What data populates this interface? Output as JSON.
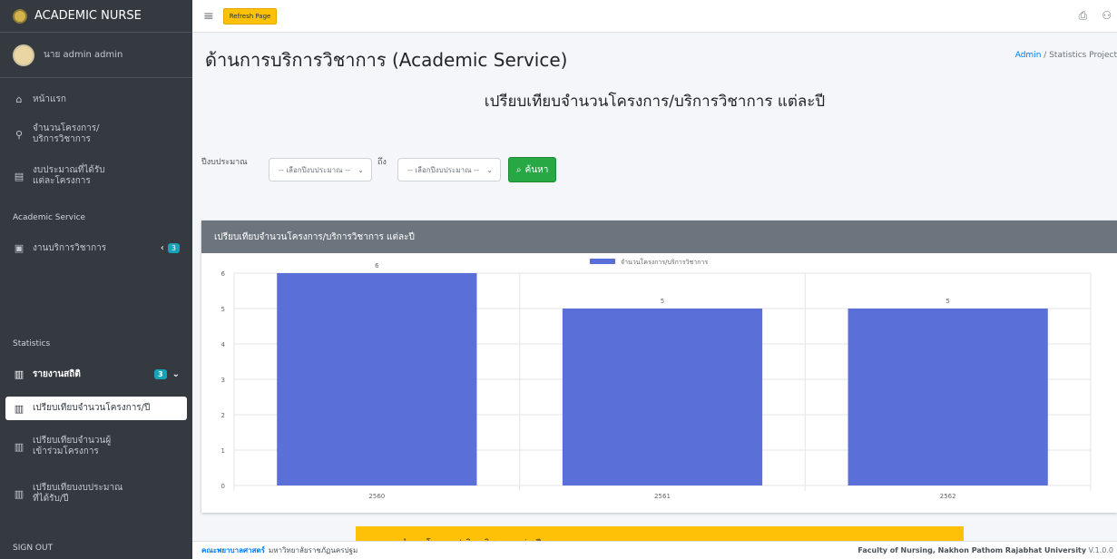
{
  "app": {
    "title": "ACADEMIC NURSE"
  },
  "user": {
    "name": "นาย admin admin"
  },
  "sidebar": {
    "items": [
      {
        "label": "หน้าแรก",
        "icon": "home-icon"
      },
      {
        "label": "จำนวนโครงการ/บริการวิชาการ",
        "icon": "project-diagram-icon"
      },
      {
        "label": "งบประมาณที่ได้รับแต่ละโครงการ",
        "icon": "money-icon"
      }
    ],
    "header_service": "Academic Service",
    "service_item": {
      "label": "งานบริการวิชาการ",
      "badge": "3"
    },
    "header_stats": "Statistics",
    "stats_item": {
      "label": "รายงานสถิติ",
      "badge": "3"
    },
    "sub_items": [
      {
        "label": "เปรียบเทียบจำนวนโครงการ/ปี"
      },
      {
        "label": "เปรียบเทียบจำนวนผู้เข้าร่วมโครงการ"
      },
      {
        "label": "เปรียบเทียบงบประมาณที่ได้รับ/ปี"
      }
    ],
    "signout": "SIGN OUT"
  },
  "topbar": {
    "refresh_label": "Refresh Page"
  },
  "page": {
    "title": "ด้านการบริการวิชาการ (Academic Service)",
    "breadcrumb_home": "Admin",
    "breadcrumb_sep": "/",
    "breadcrumb_current": "Statistics Project",
    "heading": "เปรียบเทียบจำนวนโครงการ/บริการวิชาการ แต่ละปี"
  },
  "filter": {
    "label": "ปีงบประมาณ",
    "from_placeholder": "-- เลือกปีงบประมาณ --",
    "to_label": "ถึง",
    "to_placeholder": "-- เลือกปีงบประมาณ --",
    "search_label": "ค้นหา"
  },
  "card": {
    "title": "เปรียบเทียบจำนวนโครงการ/บริการวิชาการ แต่ละปี",
    "table_title": "ตารางจำนวนโครงการ/บริการวิชาการ แต่ละปี"
  },
  "chart_data": {
    "type": "bar",
    "categories": [
      "2560",
      "2561",
      "2562"
    ],
    "series": [
      {
        "name": "จำนวนโครงการ/บริการวิชาการ",
        "values": [
          6,
          5,
          5
        ]
      }
    ],
    "ylim": [
      0,
      6
    ],
    "yticks": [
      0,
      1,
      2,
      3,
      4,
      5,
      6
    ],
    "color": "#5b6fd9",
    "legend": "top-center",
    "grid": true
  },
  "footer": {
    "faculty": "คณะพยาบาลศาสตร์",
    "university": "มหาวิทยาลัยราชภัฏนครปฐม",
    "right_text": "Faculty of Nursing, Nakhon Pathom Rajabhat University",
    "version": "V.1.0.0"
  }
}
